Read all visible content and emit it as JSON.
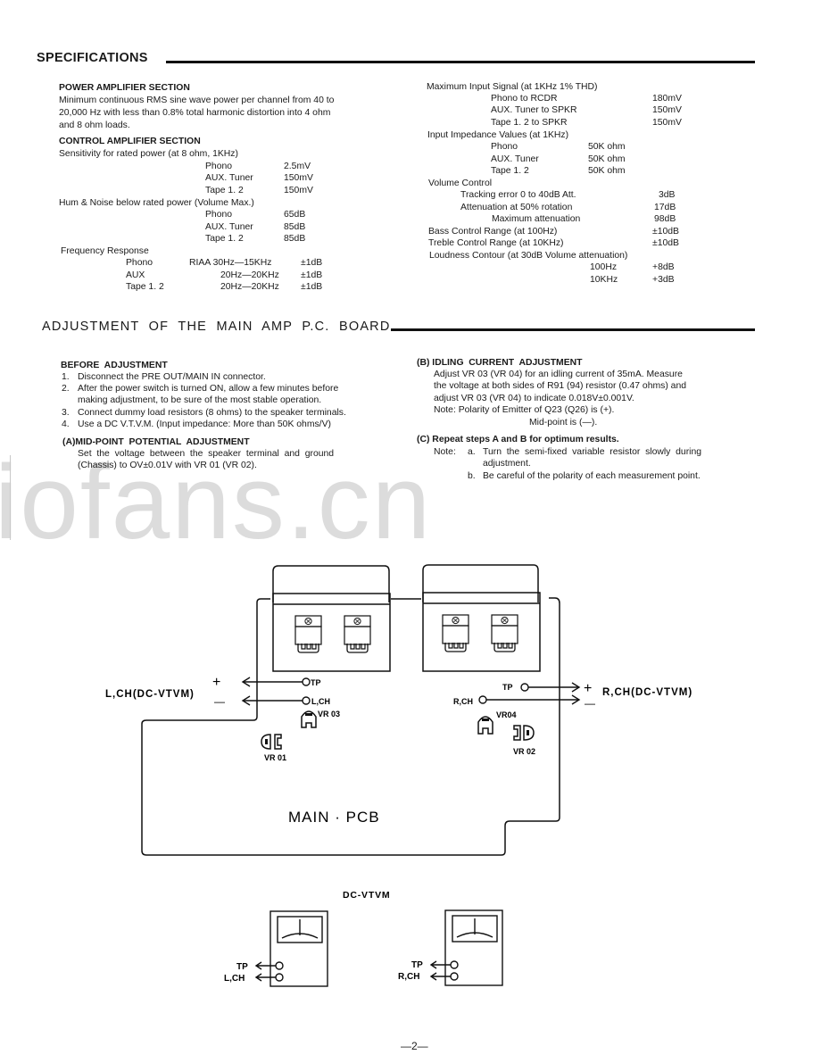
{
  "specifications": {
    "title": "SPECIFICATIONS",
    "power_amp": {
      "heading": "POWER AMPLIFIER SECTION",
      "lines": [
        "Minimum continuous RMS sine wave power per channel from 40 to",
        "20,000 Hz with less than 0.8% total harmonic distortion into 4 ohm",
        "and 8 ohm loads."
      ]
    },
    "control_amp": {
      "heading": "CONTROL AMPLIFIER SECTION",
      "sensitivity": {
        "label": "Sensitivity for rated power (at 8 ohm, 1KHz)",
        "rows": [
          {
            "input": "Phono",
            "value": "2.5mV"
          },
          {
            "input": "AUX. Tuner",
            "value": "150mV"
          },
          {
            "input": "Tape 1. 2",
            "value": "150mV"
          }
        ]
      },
      "hum_noise": {
        "label": "Hum & Noise below rated power (Volume Max.)",
        "rows": [
          {
            "input": "Phono",
            "value": "65dB"
          },
          {
            "input": "AUX. Tuner",
            "value": "85dB"
          },
          {
            "input": "Tape 1. 2",
            "value": "85dB"
          }
        ]
      },
      "frequency_response": {
        "label": "Frequency Response",
        "rows": [
          {
            "input": "Phono",
            "range": "RIAA 30Hz—15KHz",
            "tolerance": "±1dB"
          },
          {
            "input": "AUX",
            "range": "20Hz—20KHz",
            "tolerance": "±1dB"
          },
          {
            "input": "Tape 1. 2",
            "range": "20Hz—20KHz",
            "tolerance": "±1dB"
          }
        ]
      }
    },
    "right": {
      "max_input": {
        "label": "Maximum Input Signal (at 1KHz 1% THD)",
        "rows": [
          {
            "input": "Phono to RCDR",
            "value": "180mV"
          },
          {
            "input": "AUX. Tuner to SPKR",
            "value": "150mV"
          },
          {
            "input": "Tape 1. 2 to SPKR",
            "value": "150mV"
          }
        ]
      },
      "impedance": {
        "label": "Input Impedance Values (at 1KHz)",
        "rows": [
          {
            "input": "Phono",
            "value": "50K ohm"
          },
          {
            "input": "AUX. Tuner",
            "value": "50K ohm"
          },
          {
            "input": "Tape 1. 2",
            "value": "50K ohm"
          }
        ]
      },
      "volume": {
        "label": "Volume Control",
        "rows": [
          {
            "item": "Tracking error 0 to 40dB Att.",
            "value": "3dB"
          },
          {
            "item": "Attenuation at 50% rotation",
            "value": "17dB"
          },
          {
            "item": "Maximum attenuation",
            "value": "98dB"
          }
        ]
      },
      "bass": {
        "label": "Bass Control Range (at 100Hz)",
        "value": "±10dB"
      },
      "treble": {
        "label": "Treble Control Range (at 10KHz)",
        "value": "±10dB"
      },
      "loudness": {
        "label": "Loudness Contour (at 30dB Volume attenuation)",
        "rows": [
          {
            "freq": "100Hz",
            "value": "+8dB"
          },
          {
            "freq": "10KHz",
            "value": "+3dB"
          }
        ]
      }
    }
  },
  "adjustment": {
    "title": "ADJUSTMENT  OF  THE  MAIN  AMP  P.C.  BOARD",
    "before": {
      "heading": "BEFORE  ADJUSTMENT",
      "steps": [
        {
          "num": "1.",
          "text": "Disconnect the PRE OUT/MAIN IN connector."
        },
        {
          "num": "2.",
          "text": "After the power switch is turned ON, allow a few minutes before",
          "cont": "making adjustment, to be sure of the most stable operation."
        },
        {
          "num": "3.",
          "text": "Connect dummy load resistors (8 ohms) to the speaker terminals."
        },
        {
          "num": "4.",
          "text": "Use a DC V.T.V.M. (Input impedance: More than 50K ohms/V)"
        }
      ]
    },
    "mid_point": {
      "heading": "(A)MID-POINT  POTENTIAL  ADJUSTMENT",
      "lines": [
        "Set  the  voltage  between  the  speaker  terminal  and  ground",
        "(Chassis) to OV±0.01V with VR 01 (VR 02)."
      ]
    },
    "idling": {
      "heading": "(B) IDLING  CURRENT  ADJUSTMENT",
      "lines": [
        "Adjust VR 03 (VR 04) for an idling current of 35mA. Measure",
        "the voltage at both sides of R91 (94) resistor (0.47 ohms) and",
        "adjust VR 03 (VR 04) to indicate 0.018V±0.001V.",
        "Note: Polarity of Emitter of Q23 (Q26) is (+)."
      ],
      "midpoint_note": "Mid-point is (—)."
    },
    "repeat": {
      "heading": "(C) Repeat steps A and B for optimum results.",
      "note_label": "Note:",
      "note_a_label": "a.",
      "note_a": "Turn  the  semi-fixed  variable  resistor  slowly  during",
      "note_a_cont": "adjustment.",
      "note_b_label": "b.",
      "note_b": "Be careful of the polarity of each measurement point."
    }
  },
  "diagram": {
    "board_label": "MAIN · PCB",
    "left_meter_label": "L,CH(DC-VTVM)",
    "right_meter_label": "R,CH(DC-VTVM)",
    "plus": "+",
    "minus": "—",
    "tp_label": "TP",
    "lch_label": "L,CH",
    "rch_label": "R,CH",
    "vr01": "VR 01",
    "vr02": "VR 02",
    "vr03": "VR 03",
    "vr04": "VR04",
    "vtvm_title": "DC-VTVM",
    "meter_tp": "TP",
    "meter_lch": "L,CH",
    "meter_rch": "R,CH"
  },
  "watermark": "iofans.cn",
  "page_number": "—2—"
}
